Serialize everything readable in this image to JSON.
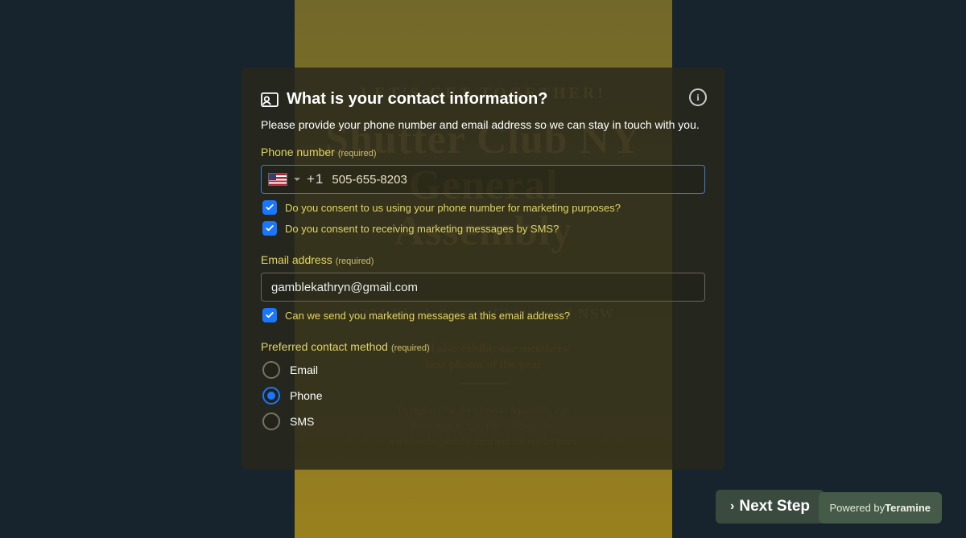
{
  "poster": {
    "kicker": "LET'S GET TOGETHER!",
    "title_html": "Shutter Club NY<br>General<br>Assembly",
    "addr": "1234 Black Street. Chatswood NSW",
    "mid_html": "We will also exhibit our members'<br>best photos of the year",
    "reg_html": "To register for the General Assembly, call<br>Benjamin at 123-456-7890 or visit<br>www.reallygreatsite.com and fill up the form."
  },
  "modal": {
    "title": "What is your contact information?",
    "desc": "Please provide your phone number and email address so we can stay in touch with you.",
    "phone_label": "Phone number",
    "required": "(required)",
    "phone_prefix": "+1",
    "phone_value": "505-655-8203",
    "consent_phone_marketing": "Do you consent to us using your phone number for marketing purposes?",
    "consent_sms": "Do you consent to receiving marketing messages by SMS?",
    "email_label": "Email address",
    "email_value": "gamblekathryn@gmail.com",
    "consent_email": "Can we send you marketing messages at this email address?",
    "preferred_label": "Preferred contact method",
    "radios": {
      "email": "Email",
      "phone": "Phone",
      "sms": "SMS"
    },
    "selected_radio": "phone",
    "checkbox_states": {
      "phone_marketing": true,
      "sms": true,
      "email": true
    }
  },
  "footer": {
    "next": "Next Step",
    "powered_prefix": "Powered by",
    "powered_brand": "Teramine"
  }
}
